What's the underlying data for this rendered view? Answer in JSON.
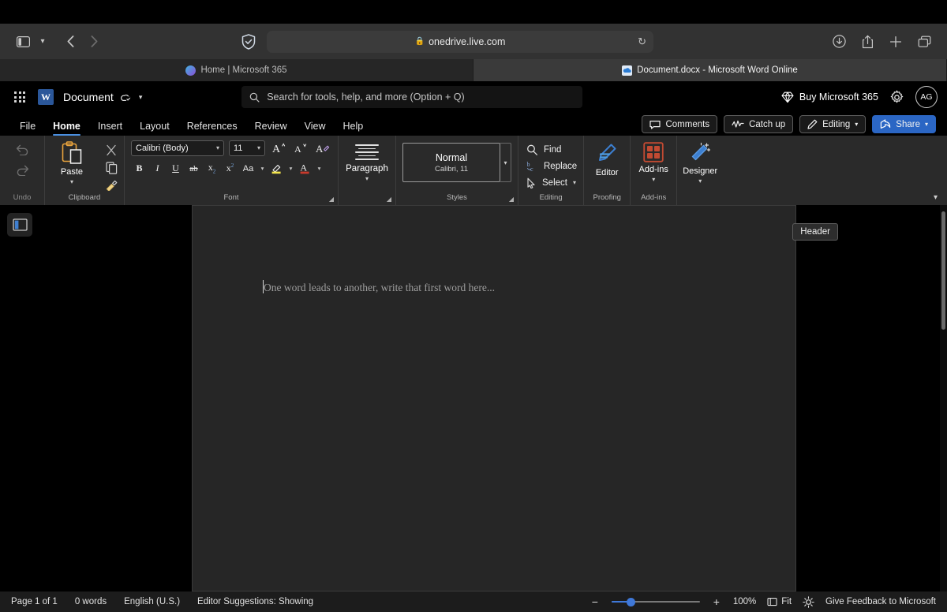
{
  "browser": {
    "url": "onedrive.live.com",
    "lock_icon": "lock-icon",
    "sidebar_icon": "sidebar-toggle-icon",
    "back_icon": "back-chevron-icon",
    "forward_icon": "forward-chevron-icon",
    "shield_icon": "adblock-shield-icon",
    "reload_icon": "reload-icon",
    "downloads_icon": "downloads-icon",
    "share_icon": "share-icon",
    "newtab_icon": "plus-icon",
    "tabs_overview_icon": "tab-overview-icon",
    "tabs": [
      {
        "title": "Home | Microsoft 365",
        "icon": "edge-start-icon",
        "active": false
      },
      {
        "title": "Document.docx - Microsoft Word Online",
        "icon": "onedrive-cloud-icon",
        "active": true
      }
    ]
  },
  "header": {
    "app_launcher": "waffle-grid-icon",
    "app_icon_letter": "W",
    "document_title": "Document",
    "saved_icon": "cloud-saved-icon",
    "title_chevron": "chevron-down-icon",
    "search_placeholder": "Search for tools, help, and more (Option + Q)",
    "search_value": "",
    "search_icon": "search-icon",
    "buy_label": "Buy Microsoft 365",
    "buy_icon": "diamond-icon",
    "settings_icon": "gear-icon",
    "avatar_initials": "AG"
  },
  "ribbon_tabs": {
    "items": [
      {
        "label": "File",
        "active": false
      },
      {
        "label": "Home",
        "active": true
      },
      {
        "label": "Insert",
        "active": false
      },
      {
        "label": "Layout",
        "active": false
      },
      {
        "label": "References",
        "active": false
      },
      {
        "label": "Review",
        "active": false
      },
      {
        "label": "View",
        "active": false
      },
      {
        "label": "Help",
        "active": false
      }
    ],
    "accent_color": "#4a8fe0",
    "actions": [
      {
        "label": "Comments",
        "icon": "comment-bubble-icon",
        "primary": false
      },
      {
        "label": "Catch up",
        "icon": "catch-up-icon",
        "primary": false
      },
      {
        "label": "Editing",
        "icon": "pencil-icon",
        "chevron": true,
        "primary": false
      },
      {
        "label": "Share",
        "icon": "share-person-icon",
        "chevron": true,
        "primary": true
      }
    ],
    "share_color": "#2b66c4"
  },
  "ribbon": {
    "groups": [
      {
        "name": "Undo",
        "label": "Undo"
      },
      {
        "name": "Clipboard",
        "label": "Clipboard"
      },
      {
        "name": "Font",
        "label": "Font"
      },
      {
        "name": "Paragraph",
        "label": ""
      },
      {
        "name": "Styles",
        "label": "Styles"
      },
      {
        "name": "Editing",
        "label": "Editing"
      },
      {
        "name": "Proofing",
        "label": "Proofing"
      },
      {
        "name": "Add-ins",
        "label": "Add-ins"
      }
    ],
    "undo_label": "Undo",
    "undo_icon": "undo-arrow-icon",
    "redo_icon": "redo-arrow-icon",
    "paste_label": "Paste",
    "paste_icon": "clipboard-icon",
    "cut_icon": "scissors-icon",
    "copy_icon": "copy-icon",
    "format_painter_icon": "format-painter-icon",
    "clipboard_label": "Clipboard",
    "font_name": "Calibri (Body)",
    "font_size": "11",
    "grow_font_icon": "grow-font-icon",
    "shrink_font_icon": "shrink-font-icon",
    "clear_format_icon": "clear-formatting-icon",
    "bold_icon": "bold-icon",
    "italic_icon": "italic-icon",
    "underline_icon": "underline-icon",
    "strikethrough_icon": "strikethrough-icon",
    "subscript_icon": "subscript-icon",
    "superscript_icon": "superscript-icon",
    "change_case_icon": "change-case-icon",
    "highlight_icon": "text-highlight-icon",
    "highlight_color": "#f2e34c",
    "font_color_icon": "font-color-icon",
    "font_color": "#c8392b",
    "font_label": "Font",
    "paragraph_label": "Paragraph",
    "paragraph_icon": "paragraph-lines-icon",
    "style_name": "Normal",
    "style_font": "Calibri, 11",
    "styles_label": "Styles",
    "find_label": "Find",
    "find_icon": "magnifier-icon",
    "replace_label": "Replace",
    "replace_icon": "replace-icon",
    "select_label": "Select",
    "select_icon": "cursor-arrow-icon",
    "editing_label": "Editing",
    "editor_label": "Editor",
    "editor_icon": "editor-pen-icon",
    "proofing_label": "Proofing",
    "addins_label": "Add-ins",
    "addins_icon": "addins-grid-icon",
    "addins_group_label": "Add-ins",
    "designer_label": "Designer",
    "designer_icon": "designer-wand-icon",
    "collapse_icon": "chevron-down-icon"
  },
  "document": {
    "nav_pane_icon": "navigation-pane-icon",
    "header_label": "Header",
    "placeholder": "One word leads to another, write that first word here..."
  },
  "status": {
    "page": "Page 1 of 1",
    "words": "0 words",
    "language": "English (U.S.)",
    "editor": "Editor Suggestions: Showing",
    "zoom_out_icon": "minus-icon",
    "zoom_in_icon": "plus-icon",
    "zoom_value": "100%",
    "zoom_percent": 22,
    "fit_label": "Fit",
    "fit_icon": "fit-page-icon",
    "focus_icon": "focus-mode-icon",
    "feedback": "Give Feedback to Microsoft",
    "accent_color": "#3f78d8"
  }
}
